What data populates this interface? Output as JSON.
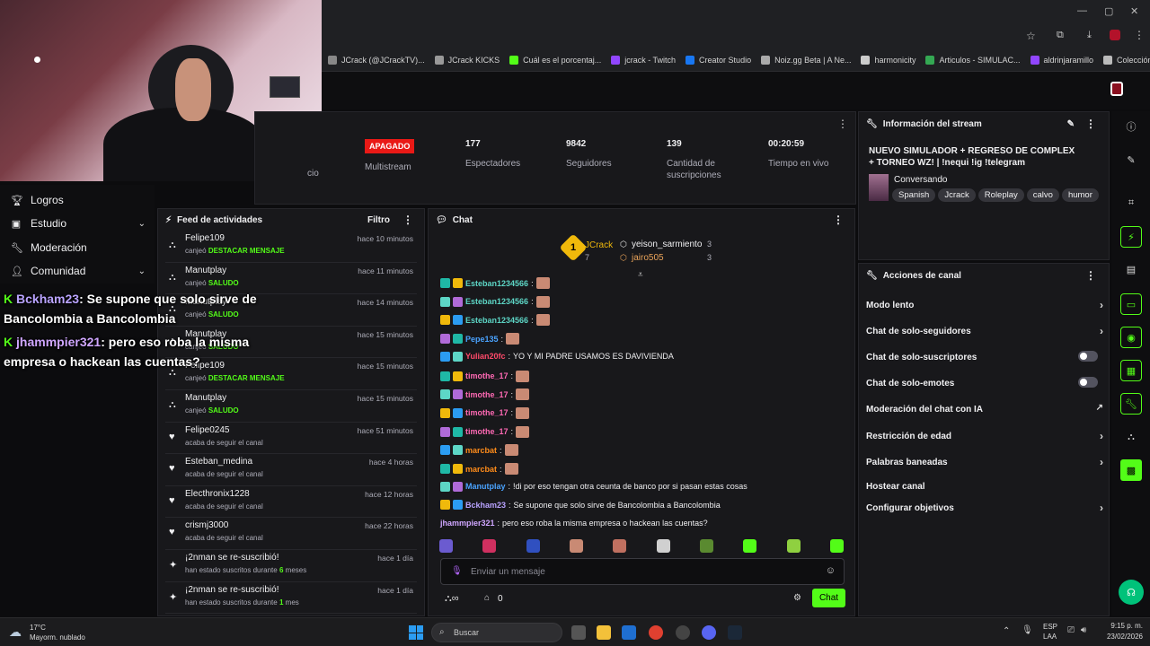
{
  "browser": {
    "bookmarks": [
      {
        "label": "JCrack (@JCrackTV)...",
        "color": "#888"
      },
      {
        "label": "JCrack KICKS",
        "color": "#999"
      },
      {
        "label": "Cuál es el porcentaj...",
        "color": "#53fc18"
      },
      {
        "label": "jcrack - Twitch",
        "color": "#9146ff"
      },
      {
        "label": "Creator Studio",
        "color": "#1877f2"
      },
      {
        "label": "Noiz.gg Beta | A Ne...",
        "color": "#aaa"
      },
      {
        "label": "harmonicity",
        "color": "#ccc"
      },
      {
        "label": "Articulos - SIMULAC...",
        "color": "#34a853"
      },
      {
        "label": "aldrinjaramillo",
        "color": "#9146ff"
      },
      {
        "label": "Colección de M_blei...",
        "color": "#bbb"
      }
    ]
  },
  "overlay": {
    "msg1_user": "Bckham23",
    "msg1_text": ": Se supone que solo sirve de Bancolombia a Bancolombia",
    "msg2_user": "jhammpier321",
    "msg2_text": ": pero eso roba la misma empresa o hackean las cuentas?"
  },
  "nav": {
    "items": [
      {
        "label": "Logros",
        "icon": "trophy-icon"
      },
      {
        "label": "Estudio",
        "icon": "studio-icon"
      },
      {
        "label": "Moderación",
        "icon": "wrench-icon"
      },
      {
        "label": "Comunidad",
        "icon": "community-icon"
      }
    ]
  },
  "stats": {
    "partial_label": "cio",
    "status_badge": "APAGADO",
    "multistream_label": "Multistream",
    "items": [
      {
        "value": "177",
        "label": "Espectadores"
      },
      {
        "value": "9842",
        "label": "Seguidores"
      },
      {
        "value": "139",
        "label": "Cantidad de suscripciones"
      },
      {
        "value": "00:20:59",
        "label": "Tiempo en vivo"
      }
    ]
  },
  "feed": {
    "title": "Feed de actividades",
    "filter_label": "Filtro",
    "items": [
      {
        "name": "Felipe109",
        "desc": "canjeó",
        "highlight": "DESTACAR MENSAJE",
        "time": "hace 10 minutos",
        "icon": "points-icon"
      },
      {
        "name": "Manutplay",
        "desc": "canjeó",
        "highlight": "SALUDO",
        "time": "hace 11 minutos",
        "icon": "points-icon"
      },
      {
        "name": "Manutplay",
        "desc": "canjeó",
        "highlight": "SALUDO",
        "time": "hace 14 minutos",
        "icon": "points-icon"
      },
      {
        "name": "Manutplay",
        "desc": "canjeó",
        "highlight": "SALUDO",
        "time": "hace 15 minutos",
        "icon": "points-icon"
      },
      {
        "name": "Felipe109",
        "desc": "canjeó",
        "highlight": "DESTACAR MENSAJE",
        "time": "hace 15 minutos",
        "icon": "points-icon"
      },
      {
        "name": "Manutplay",
        "desc": "canjeó",
        "highlight": "SALUDO",
        "time": "hace 15 minutos",
        "icon": "points-icon"
      },
      {
        "name": "Felipe0245",
        "desc": "acaba de seguir el canal",
        "highlight": "",
        "time": "hace 51 minutos",
        "icon": "heart-icon"
      },
      {
        "name": "Esteban_medina",
        "desc": "acaba de seguir el canal",
        "highlight": "",
        "time": "hace 4 horas",
        "icon": "heart-icon"
      },
      {
        "name": "Electhronix1228",
        "desc": "acaba de seguir el canal",
        "highlight": "",
        "time": "hace 12 horas",
        "icon": "heart-icon"
      },
      {
        "name": "crismj3000",
        "desc": "acaba de seguir el canal",
        "highlight": "",
        "time": "hace 22 horas",
        "icon": "heart-icon"
      },
      {
        "name": "¡2nman se re-suscribió!",
        "desc": "han estado suscritos durante",
        "highlight": "6",
        "desc2": "meses",
        "time": "hace 1 día",
        "icon": "sparkle-icon"
      },
      {
        "name": "¡2nman se re-suscribió!",
        "desc": "han estado suscritos durante",
        "highlight": "1",
        "desc2": "mes",
        "time": "hace 1 día",
        "icon": "sparkle-icon"
      }
    ]
  },
  "chat": {
    "title": "Chat",
    "leaderboard": {
      "first": {
        "name": "JCrack",
        "count": "7",
        "rank": "1"
      },
      "second": {
        "name": "yeison_sarmiento",
        "count": "3"
      },
      "third": {
        "name": "jairo505",
        "count": "3"
      }
    },
    "messages": [
      {
        "user": "Esteban1234566",
        "text": "",
        "color": "#5dd6c6",
        "emote": true
      },
      {
        "user": "Esteban1234566",
        "text": "",
        "color": "#5dd6c6",
        "emote": true
      },
      {
        "user": "Esteban1234566",
        "text": "",
        "color": "#5dd6c6",
        "emote": true
      },
      {
        "user": "Pepe135",
        "text": "",
        "color": "#4aa3ff",
        "emote": true
      },
      {
        "user": "Yulian20fc",
        "text": "YO Y MI PADRE USAMOS ES DAVIVIENDA",
        "color": "#ff4a6a",
        "emote": false
      },
      {
        "user": "timothe_17",
        "text": "",
        "color": "#ff69b4",
        "emote": true
      },
      {
        "user": "timothe_17",
        "text": "",
        "color": "#ff69b4",
        "emote": true
      },
      {
        "user": "timothe_17",
        "text": "",
        "color": "#ff69b4",
        "emote": true
      },
      {
        "user": "timothe_17",
        "text": "",
        "color": "#ff69b4",
        "emote": true
      },
      {
        "user": "marcbat",
        "text": "",
        "color": "#ff8c1a",
        "emote": true
      },
      {
        "user": "marcbat",
        "text": "",
        "color": "#ff8c1a",
        "emote": true
      },
      {
        "user": "Manutplay",
        "text": "!di por eso tengan otra ceunta de banco por si pasan estas cosas",
        "color": "#4aa3ff",
        "emote": false
      },
      {
        "user": "Bckham23",
        "text": "Se supone que solo sirve de Bancolombia a Bancolombia",
        "color": "#b9a3ff",
        "emote": false
      },
      {
        "user": "jhammpier321",
        "text": "pero eso roba la misma empresa o hackean las cuentas?",
        "color": "#cfa6ff",
        "emote": false
      }
    ],
    "input_placeholder": "Enviar un mensaje",
    "points_count": "0",
    "send_label": "Chat"
  },
  "info": {
    "title": "Información del stream",
    "stream_title": "NUEVO SIMULADOR + REGRESO DE COMPLEX + TORNEO WZ! | !nequi !ig !telegram",
    "category": "Conversando",
    "tags": [
      "Spanish",
      "Jcrack",
      "Roleplay",
      "calvo",
      "humor"
    ]
  },
  "actions": {
    "title": "Acciones de canal",
    "items": [
      {
        "label": "Modo lento",
        "control": "chevron"
      },
      {
        "label": "Chat de solo-seguidores",
        "control": "chevron"
      },
      {
        "label": "Chat de solo-suscriptores",
        "control": "toggle"
      },
      {
        "label": "Chat de solo-emotes",
        "control": "toggle"
      },
      {
        "label": "Moderación del chat con IA",
        "control": "external"
      },
      {
        "label": "Restricción de edad",
        "control": "chevron"
      },
      {
        "label": "Palabras baneadas",
        "control": "chevron"
      },
      {
        "label": "Hostear canal",
        "control": "none"
      },
      {
        "label": "Configurar objetivos",
        "control": "chevron"
      }
    ]
  },
  "taskbar": {
    "weather_temp": "17°C",
    "weather_desc": "Mayorm. nublado",
    "search_placeholder": "Buscar",
    "lang": "ESP",
    "lang2": "LAA",
    "time": "9:15 p. m.",
    "date": "23/02/2026"
  },
  "colors": {
    "accent": "#53fc18",
    "offline": "#e91916",
    "panel": "#18181b"
  }
}
